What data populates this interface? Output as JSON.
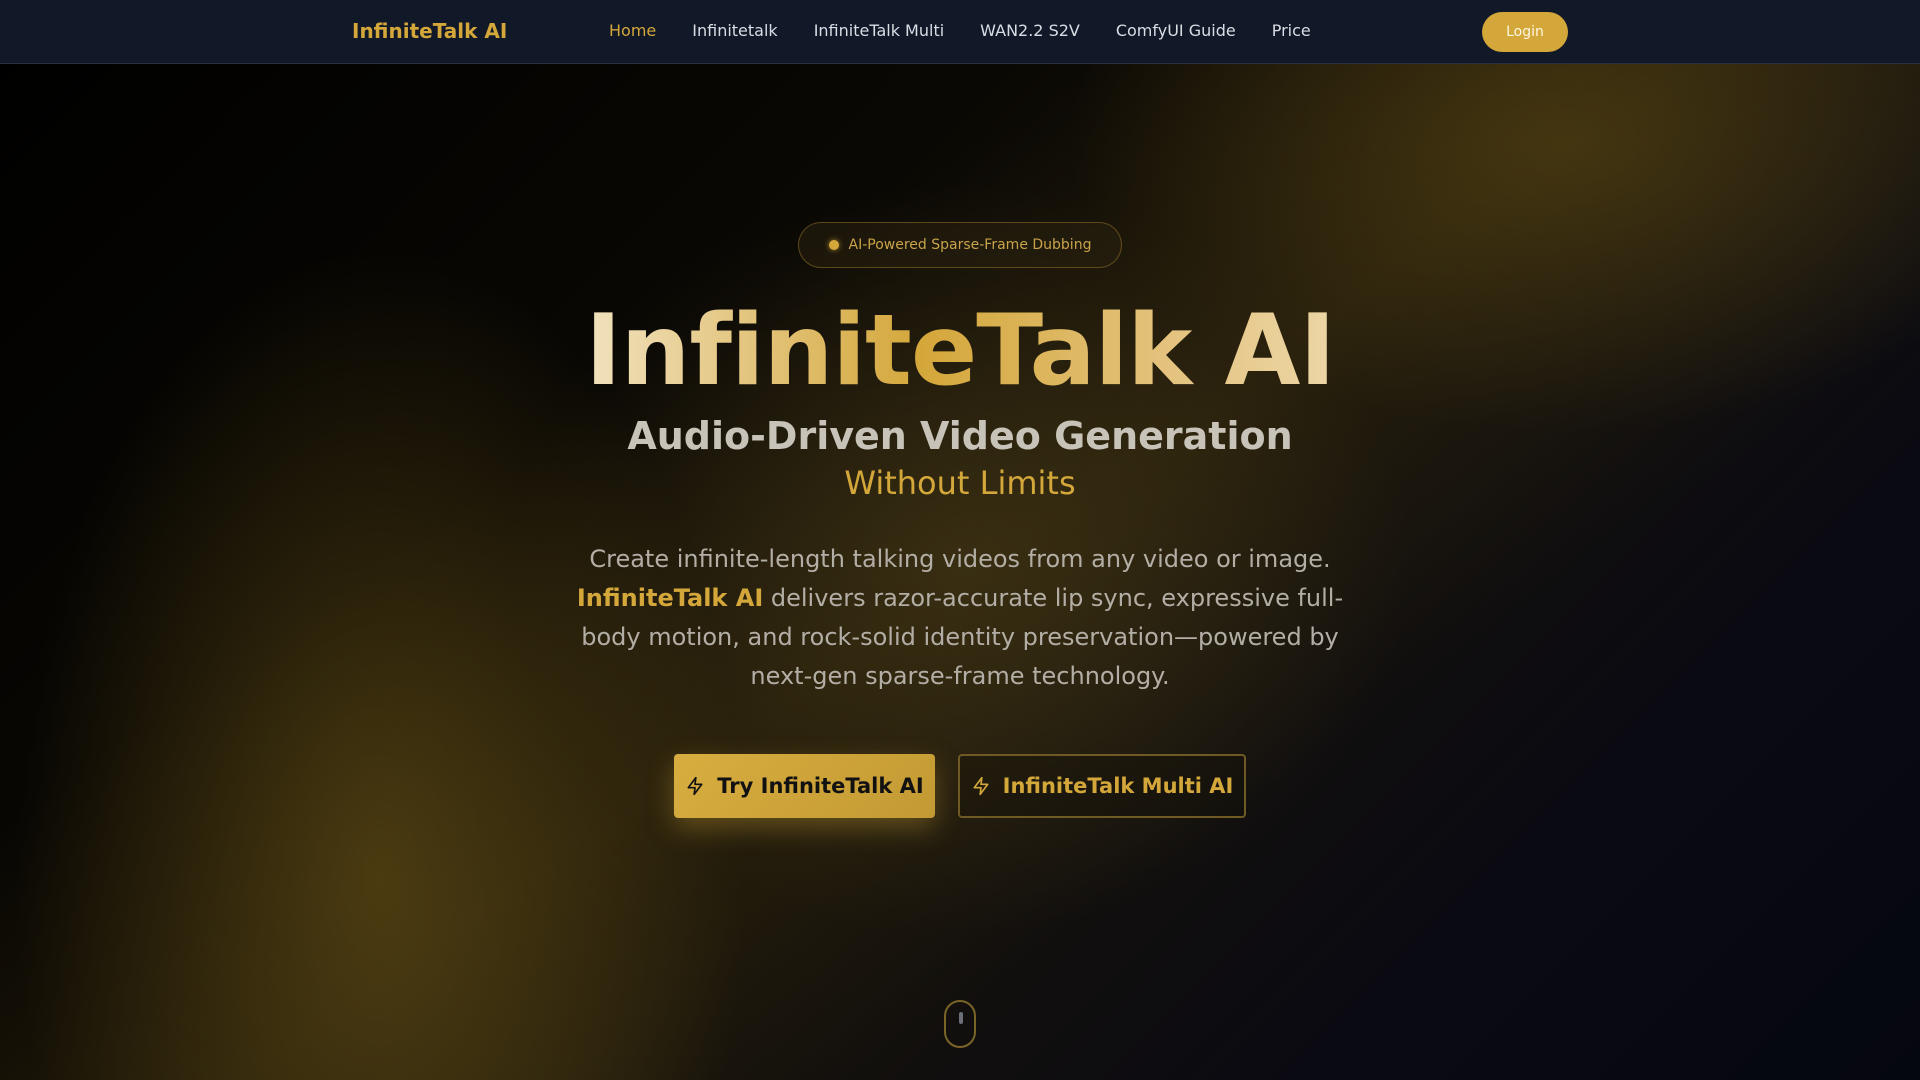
{
  "nav": {
    "brand": "InfiniteTalk AI",
    "links": [
      "Home",
      "Infinitetalk",
      "InfiniteTalk Multi",
      "WAN2.2 S2V",
      "ComfyUI Guide",
      "Price"
    ],
    "active": "Home",
    "login": "Login"
  },
  "hero": {
    "badge": "AI-Powered Sparse-Frame Dubbing",
    "title": "InfiniteTalk AI",
    "subtitle": "Audio-Driven Video Generation",
    "subtitle2": "Without Limits",
    "desc_part1": "Create infinite-length talking videos from any video or image.",
    "desc_highlight": "InfiniteTalk AI",
    "desc_part2": "delivers razor-accurate lip sync, expressive full-body motion, and rock-solid identity preservation—powered by next-gen sparse-frame technology.",
    "cta_primary": "Try InfiniteTalk AI",
    "cta_secondary": "InfiniteTalk Multi AI"
  },
  "icons": {
    "badge": "dot-icon",
    "cta": "lightning-bolt-icon",
    "scroll": "mouse-scroll-icon"
  },
  "colors": {
    "accent": "#d4a73a",
    "nav_bg": "#111827",
    "text_muted": "#b3aea5"
  }
}
